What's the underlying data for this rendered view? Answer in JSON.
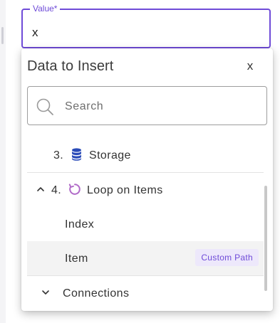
{
  "value_field": {
    "label": "Value*",
    "value": "x"
  },
  "popup": {
    "title": "Data to Insert",
    "close_label": "x",
    "search": {
      "placeholder": "Search",
      "value": ""
    },
    "items": {
      "storage": {
        "number": "3.",
        "label": "Storage",
        "icon": "database-icon"
      },
      "loop": {
        "number": "4.",
        "label": "Loop on Items",
        "icon": "loop-icon",
        "expanded": true
      },
      "index": {
        "label": "Index"
      },
      "item": {
        "label": "Item",
        "badge": "Custom Path"
      },
      "connections": {
        "label": "Connections",
        "expanded": false
      }
    }
  },
  "colors": {
    "accent": "#6f4bd8",
    "storage_icon": "#2a4bb8",
    "loop_icon": "#b06ac8",
    "badge_bg": "#ede8fb",
    "selected_row_bg": "#f3f3f3"
  }
}
